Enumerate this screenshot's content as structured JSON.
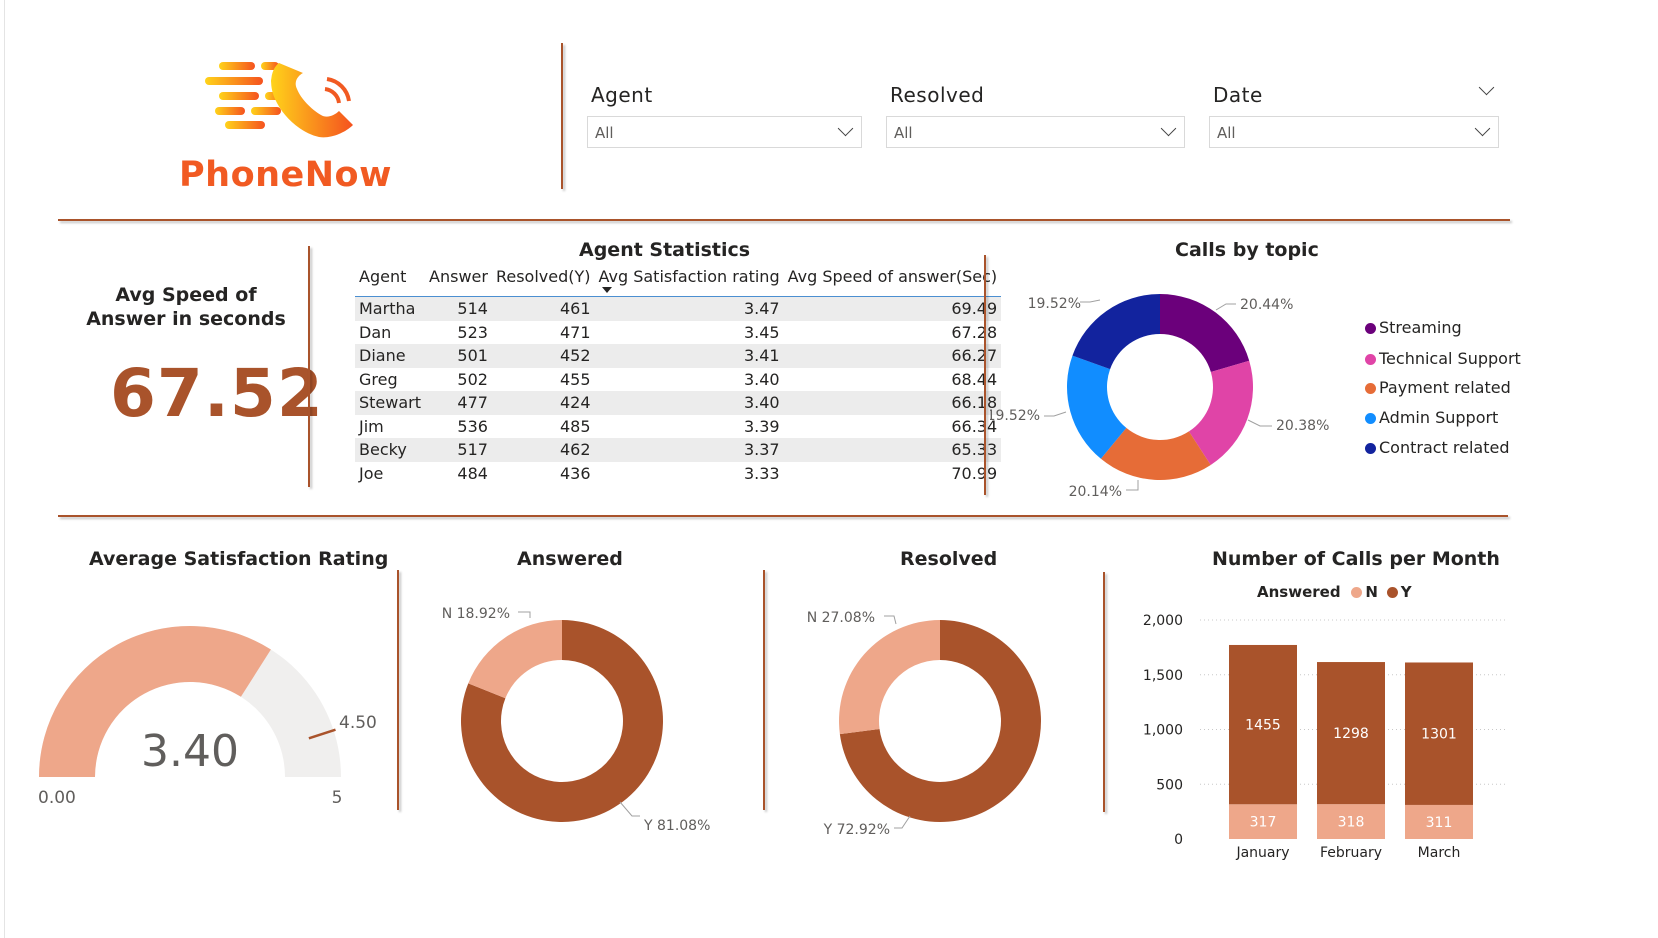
{
  "brand": {
    "name": "PhoneNow"
  },
  "filters": [
    {
      "label": "Agent",
      "value": "All"
    },
    {
      "label": "Resolved",
      "value": "All"
    },
    {
      "label": "Date",
      "value": "All"
    }
  ],
  "kpi": {
    "title": "Avg Speed of Answer in seconds",
    "value": "67.52"
  },
  "agent_table": {
    "title": "Agent Statistics",
    "columns": [
      "Agent",
      "Answer",
      "Resolved(Y)",
      "Avg Satisfaction rating",
      "Avg Speed of answer(Sec)"
    ],
    "rows": [
      [
        "Martha",
        "514",
        "461",
        "3.47",
        "69.49"
      ],
      [
        "Dan",
        "523",
        "471",
        "3.45",
        "67.28"
      ],
      [
        "Diane",
        "501",
        "452",
        "3.41",
        "66.27"
      ],
      [
        "Greg",
        "502",
        "455",
        "3.40",
        "68.44"
      ],
      [
        "Stewart",
        "477",
        "424",
        "3.40",
        "66.18"
      ],
      [
        "Jim",
        "536",
        "485",
        "3.39",
        "66.34"
      ],
      [
        "Becky",
        "517",
        "462",
        "3.37",
        "65.33"
      ],
      [
        "Joe",
        "484",
        "436",
        "3.33",
        "70.99"
      ]
    ]
  },
  "chart_data": [
    {
      "type": "pie",
      "title": "Calls by topic",
      "labels": [
        "Streaming",
        "Technical Support",
        "Payment related",
        "Admin Support",
        "Contract related"
      ],
      "values": [
        20.44,
        20.38,
        20.14,
        19.52,
        19.52
      ],
      "value_labels": [
        "20.44%",
        "20.38%",
        "20.14%",
        "19.52%",
        "19.52%"
      ],
      "colors": [
        "#6b007b",
        "#e044a7",
        "#e66c37",
        "#118dff",
        "#12239e"
      ],
      "legend": "right"
    },
    {
      "type": "gauge",
      "title": "Average Satisfaction Rating",
      "value": 3.4,
      "value_label": "3.40",
      "min": 0,
      "min_label": "0.00",
      "max": 5,
      "max_label": "5",
      "target": 4.5,
      "target_label": "4.50",
      "colors": {
        "fill": "#eea78a",
        "track": "#f0efee",
        "target": "#a9532b"
      }
    },
    {
      "type": "pie",
      "title": "Answered",
      "labels": [
        "N",
        "Y"
      ],
      "values": [
        18.92,
        81.08
      ],
      "value_labels": [
        "N 18.92%",
        "Y 81.08%"
      ],
      "colors": [
        "#eea78a",
        "#a9532b"
      ]
    },
    {
      "type": "pie",
      "title": "Resolved",
      "labels": [
        "N",
        "Y"
      ],
      "values": [
        27.08,
        72.92
      ],
      "value_labels": [
        "N 27.08%",
        "Y 72.92%"
      ],
      "colors": [
        "#eea78a",
        "#a9532b"
      ]
    },
    {
      "type": "bar",
      "stacked": true,
      "title": "Number of Calls per Month",
      "legend_title": "Answered",
      "legend": "top",
      "categories": [
        "January",
        "February",
        "March"
      ],
      "series": [
        {
          "name": "N",
          "values": [
            317,
            318,
            311
          ],
          "color": "#eea78a"
        },
        {
          "name": "Y",
          "values": [
            1455,
            1298,
            1301
          ],
          "color": "#a9532b"
        }
      ],
      "ylim": [
        0,
        2000
      ],
      "yticks": [
        "0",
        "500",
        "1,000",
        "1,500",
        "2,000"
      ],
      "grid": true
    }
  ]
}
